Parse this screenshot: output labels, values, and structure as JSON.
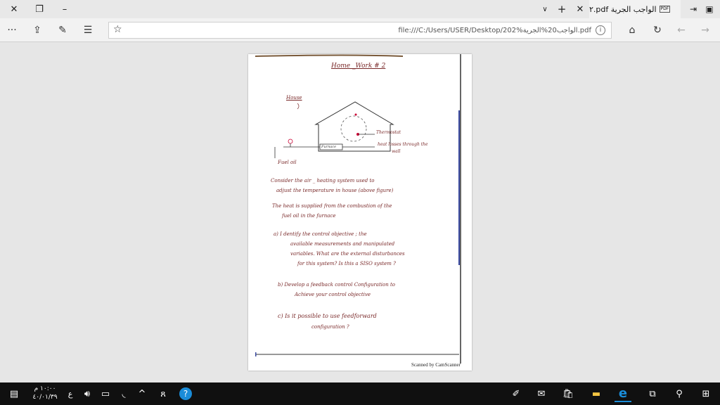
{
  "titlebar": {
    "tab_title": "الواجب الجرية pdf.٢",
    "tab_badge": "PDF"
  },
  "navbar": {
    "address": "file:///C:/Users/USER/Desktop/202%الواجب20%الجرية.pdf",
    "more": "···"
  },
  "document": {
    "title": "Home _Work # 2",
    "house_label": "House",
    "thermostat_label": "Thermostat",
    "furnace_label": "Furnace",
    "heat_loss_label": "heat losses through the",
    "wall_label": "wall",
    "fuel_label": "Fuel oil",
    "para1_line1": "Consider the air _ heating system used to",
    "para1_line2": "adjust the temperature in house (above figure)",
    "para2_line1": "The heat is supplied from the combustion of the",
    "para2_line2": "fuel oil in the furnace",
    "qa_line1": "a) I dentify the control objective ; the",
    "qa_line2": "available measurements and manipulated",
    "qa_line3": "variables. What are the external disturbances",
    "qa_line4": "for this system? Is this a SISO system ?",
    "qb_line1": "b) Develop a feedback control Configuration to",
    "qb_line2": "Achieve your control objective",
    "qc_line1": "c) Is it possible to use feedforward",
    "qc_line2": "configuration ?",
    "scanned": "Scanned by CamScanner"
  },
  "taskbar": {
    "time": "١٠:٠٠ م",
    "date": "٤٠/٠١/٣٩",
    "lang": "ع"
  }
}
